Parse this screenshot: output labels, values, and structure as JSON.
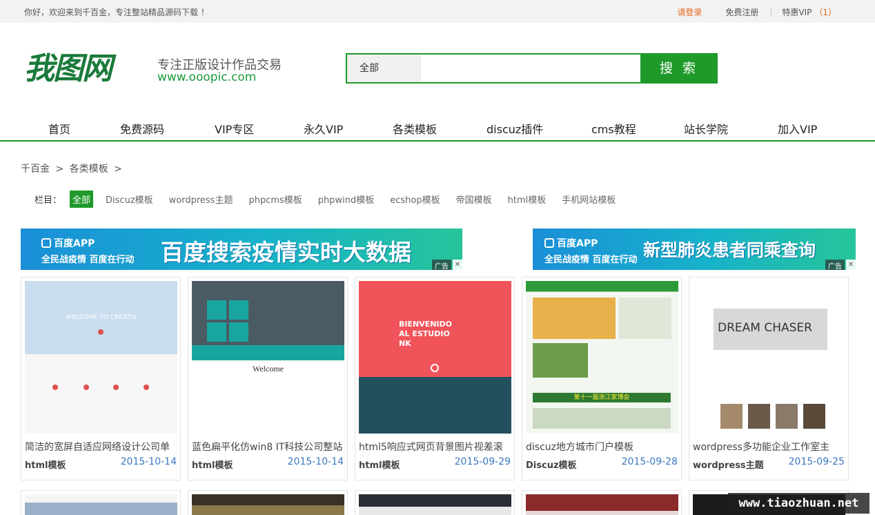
{
  "topbar": {
    "welcome": "你好，欢迎来到千百金，专注整站精品源码下载 ！",
    "login": "请登录",
    "register": "免费注册",
    "vip": "特惠VIP",
    "vip_count": "（1）"
  },
  "header": {
    "logo_text": "我图网",
    "slogan": "专注正版设计作品交易",
    "url": "www.ooopic.com"
  },
  "search": {
    "category": "全部",
    "placeholder": "",
    "button": "搜 索"
  },
  "nav": [
    {
      "label": "首页"
    },
    {
      "label": "免费源码"
    },
    {
      "label": "VIP专区"
    },
    {
      "label": "永久VIP"
    },
    {
      "label": "各类模板"
    },
    {
      "label": "discuz插件"
    },
    {
      "label": "cms教程"
    },
    {
      "label": "站长学院"
    },
    {
      "label": "加入VIP"
    }
  ],
  "breadcrumb": {
    "home": "千百金",
    "sep1": ">",
    "current": "各类模板",
    "sep2": ">"
  },
  "filter": {
    "label": "栏目：",
    "chips": [
      "全部",
      "Discuz模板",
      "wordpress主题",
      "phpcms模板",
      "phpwind模板",
      "ecshop模板",
      "帝国模板",
      "html模板",
      "手机网站模板"
    ]
  },
  "ads": [
    {
      "app": "百度APP",
      "sub": "全民战疫情 百度在行动",
      "headline": "百度搜索疫情实时大数据",
      "tag": "广告",
      "close": "✕"
    },
    {
      "app": "百度APP",
      "sub": "全民战疫情 百度在行动",
      "headline": "新型肺炎患者同乘查询",
      "tag": "广告",
      "close": "✕"
    }
  ],
  "cards": [
    {
      "title": "简洁的宽屏自适应网络设计公司单",
      "category": "html模板",
      "date": "2015-10-14",
      "thumb_text": "WELCOME TO CREATIV"
    },
    {
      "title": "蓝色扁平化仿win8 IT科技公司整站",
      "category": "html模板",
      "date": "2015-10-14",
      "thumb_text": "Welcome"
    },
    {
      "title": "html5响应式网页背景图片视差滚",
      "category": "html模板",
      "date": "2015-09-29",
      "thumb_text": "BIENVENIDO AL ESTUDIO NK"
    },
    {
      "title": "discuz地方城市门户模板",
      "category": "Discuz模板",
      "date": "2015-09-28",
      "thumb_text": "第十一届浙江家博会"
    },
    {
      "title": "wordpress多功能企业工作室主",
      "category": "wordpress主题",
      "date": "2015-09-25",
      "thumb_text": "DREAM CHASER"
    }
  ],
  "watermark": "www.tiaozhuan.net"
}
